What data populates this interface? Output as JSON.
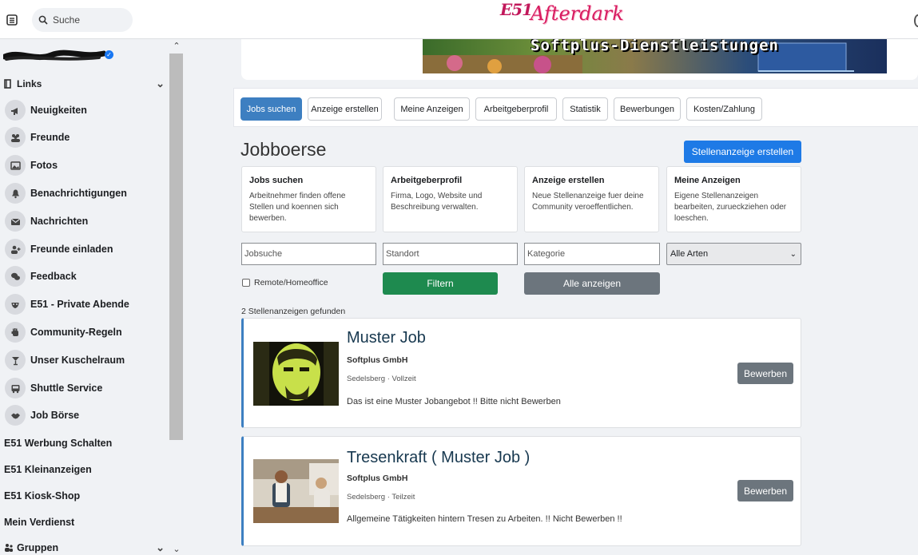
{
  "topbar": {
    "search_placeholder": "Suche",
    "logo_part1": "E51",
    "logo_part2": "Afterdark"
  },
  "sidebar": {
    "links_header": "Links",
    "items": [
      {
        "label": "Neuigkeiten",
        "icon": "megaphone-icon"
      },
      {
        "label": "Freunde",
        "icon": "friends-icon"
      },
      {
        "label": "Fotos",
        "icon": "photo-icon"
      },
      {
        "label": "Benachrichtigungen",
        "icon": "bell-icon"
      },
      {
        "label": "Nachrichten",
        "icon": "mail-icon"
      },
      {
        "label": "Freunde einladen",
        "icon": "user-plus-icon"
      },
      {
        "label": "Feedback",
        "icon": "chat-icon"
      },
      {
        "label": "E51 - Private Abende",
        "icon": "mask-icon"
      },
      {
        "label": "Community-Regeln",
        "icon": "hand-icon"
      },
      {
        "label": "Unser Kuschelraum",
        "icon": "cocktail-icon"
      },
      {
        "label": "Shuttle Service",
        "icon": "bus-icon"
      },
      {
        "label": "Job Börse",
        "icon": "handshake-icon"
      }
    ],
    "plain_items": [
      "E51 Werbung Schalten",
      "E51 Kleinanzeigen",
      "E51 Kiosk-Shop",
      "Mein Verdienst"
    ],
    "groups_header": "Gruppen"
  },
  "banner": {
    "text": "Softplus-Dienstleistungen"
  },
  "tabs": [
    {
      "label": "Jobs suchen",
      "active": true
    },
    {
      "label": "Anzeige erstellen",
      "active": false
    },
    {
      "label": "Meine Anzeigen",
      "active": false
    },
    {
      "label": "Arbeitgeberprofil",
      "active": false
    },
    {
      "label": "Statistik",
      "active": false
    },
    {
      "label": "Bewerbungen",
      "active": false
    },
    {
      "label": "Kosten/Zahlung",
      "active": false
    }
  ],
  "main": {
    "title": "Jobboerse",
    "create_button": "Stellenanzeige erstellen",
    "info_cards": [
      {
        "title": "Jobs suchen",
        "desc": "Arbeitnehmer finden offene Stellen und koennen sich bewerben."
      },
      {
        "title": "Arbeitgeberprofil",
        "desc": "Firma, Logo, Website und Beschreibung verwalten."
      },
      {
        "title": "Anzeige erstellen",
        "desc": "Neue Stellenanzeige fuer deine Community veroeffentlichen."
      },
      {
        "title": "Meine Anzeigen",
        "desc": "Eigene Stellenanzeigen bearbeiten, zurueckziehen oder loeschen."
      }
    ],
    "filters": {
      "job_placeholder": "Jobsuche",
      "location_placeholder": "Standort",
      "category_placeholder": "Kategorie",
      "type_selected": "Alle Arten",
      "remote_label": "Remote/Homeoffice",
      "filter_button": "Filtern",
      "show_all_button": "Alle anzeigen"
    },
    "result_count": "2 Stellenanzeigen gefunden",
    "jobs": [
      {
        "title": "Muster Job",
        "company": "Softplus GmbH",
        "meta": "Sedelsberg · Vollzeit",
        "desc": "Das ist eine Muster Jobangebot !! Bitte nicht Bewerben",
        "apply": "Bewerben"
      },
      {
        "title": "Tresenkraft ( Muster Job )",
        "company": "Softplus GmbH",
        "meta": "Sedelsberg · Teilzeit",
        "desc": "Allgemeine Tätigkeiten hintern Tresen zu Arbeiten. !! Nicht Bewerben !!",
        "apply": "Bewerben"
      }
    ]
  }
}
